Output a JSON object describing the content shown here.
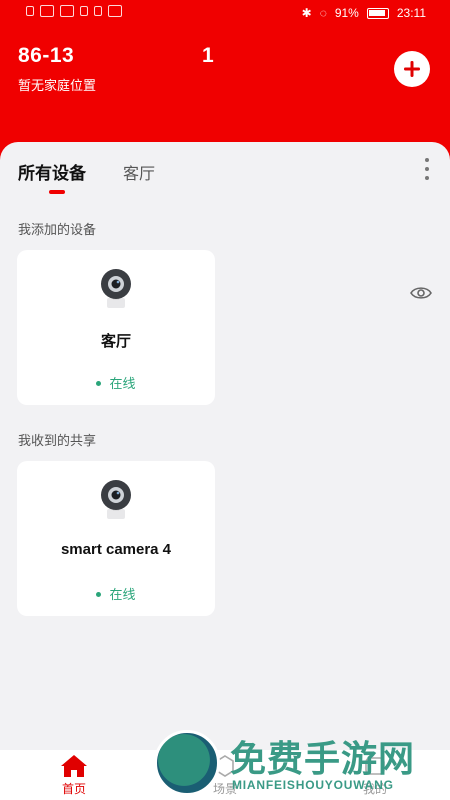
{
  "status_bar": {
    "battery": "91%",
    "time": "23:11"
  },
  "header": {
    "home_id": "86-13",
    "home_count": "1",
    "location": "暂无家庭位置"
  },
  "tabs": [
    {
      "label": "所有设备"
    },
    {
      "label": "客厅"
    }
  ],
  "sections": {
    "added": {
      "title": "我添加的设备"
    },
    "shared": {
      "title": "我收到的共享"
    }
  },
  "devices_added": [
    {
      "name": "客厅",
      "status": "在线"
    }
  ],
  "devices_shared": [
    {
      "name": "smart camera 4",
      "status": "在线"
    }
  ],
  "tabbar": {
    "home": "首页",
    "scene": "场景",
    "mine": "我的"
  },
  "watermark": {
    "title": "免费手游网",
    "subtitle": "MIANFEISHOUYOUWANG"
  },
  "colors": {
    "accent": "#f00000",
    "online": "#2aa57a",
    "background": "#f2f2f4"
  }
}
